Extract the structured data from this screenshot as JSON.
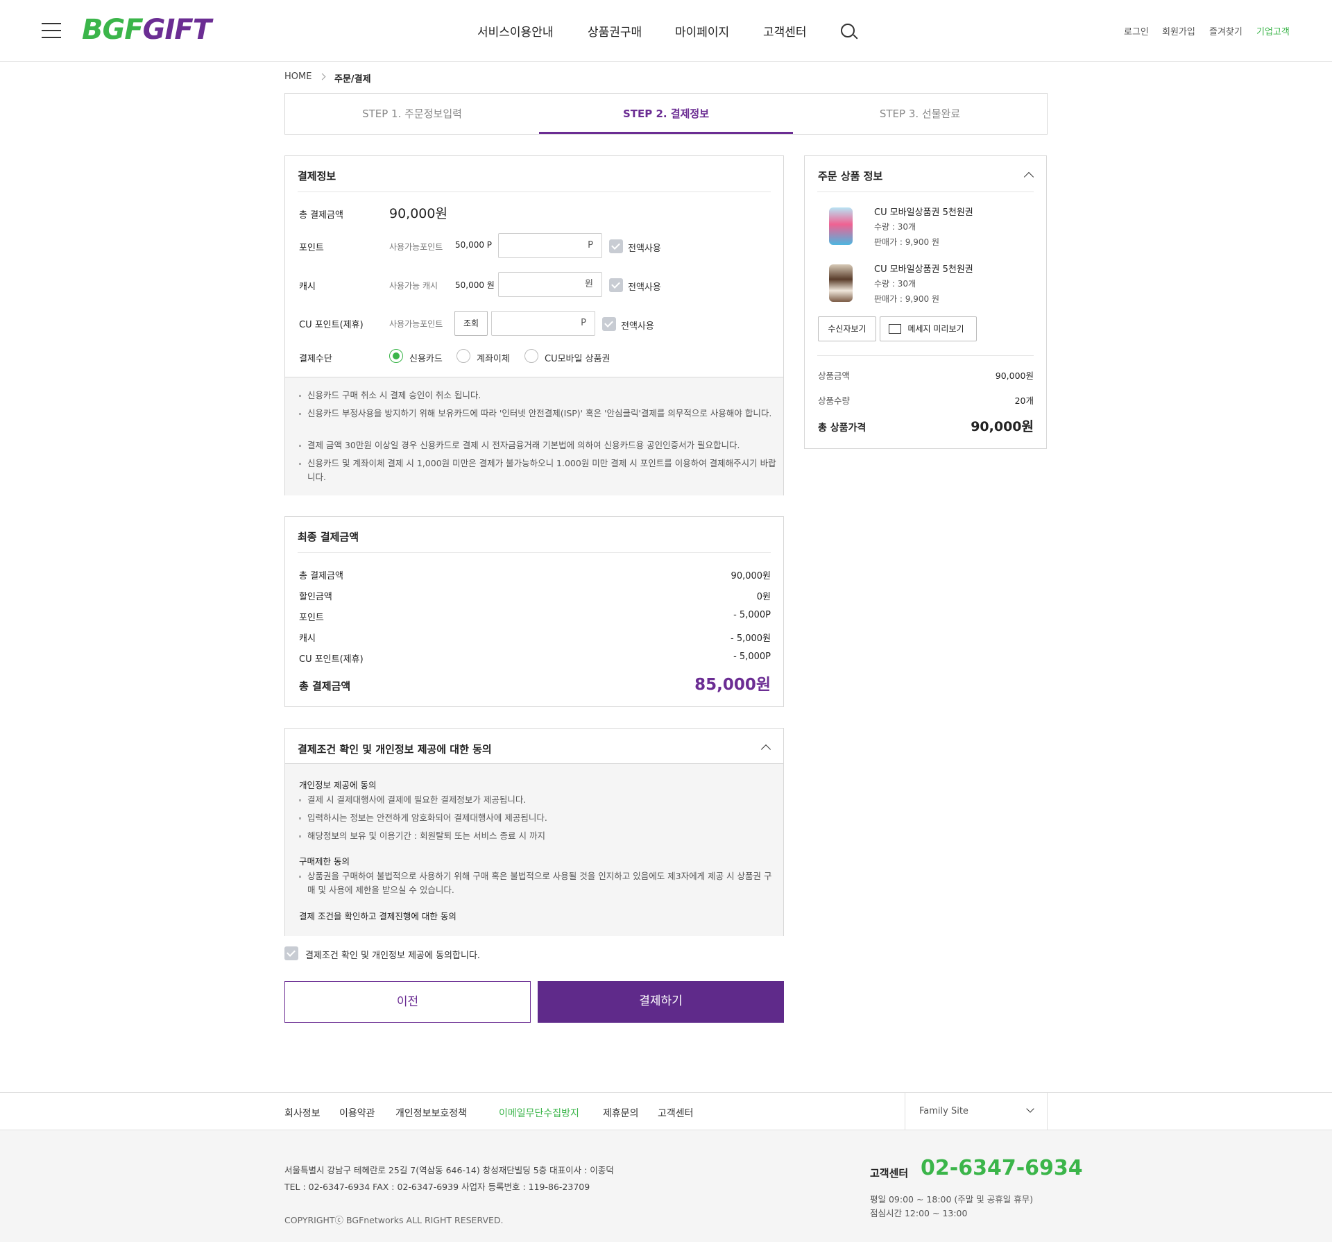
{
  "header": {
    "logo_left": "BGF",
    "logo_right": "GIFT",
    "nav": [
      "서비스이용안내",
      "상품권구매",
      "마이페이지",
      "고객센터"
    ],
    "util": [
      "로그인",
      "회원가입",
      "즐겨찾기",
      "기업고객"
    ]
  },
  "breadcrumb": {
    "home": "HOME",
    "current": "주문/결제"
  },
  "steps": [
    "STEP 1. 주문정보입력",
    "STEP 2. 결제정보",
    "STEP 3. 선물완료"
  ],
  "payment_info": {
    "title": "결제정보",
    "total_label": "총 결제금액",
    "total_value": "90,000원",
    "point": {
      "label": "포인트",
      "sub": "사용가능포인트",
      "avail": "50,000 P",
      "unit": "P",
      "check": "전액사용"
    },
    "cash": {
      "label": "캐시",
      "sub": "사용가능 캐시",
      "avail": "50,000 원",
      "unit": "원",
      "check": "전액사용"
    },
    "cupoint": {
      "label": "CU 포인트(제휴)",
      "sub": "사용가능포인트",
      "lookup": "조회",
      "unit": "P",
      "check": "전액사용"
    },
    "method": {
      "label": "결제수단",
      "options": [
        "신용카드",
        "계좌이체",
        "CU모바일 상품권"
      ],
      "selected": "신용카드"
    },
    "notices": [
      "신용카드 구매 취소 시 결제 승인이 취소 됩니다.",
      "신용카드 부정사용을 방지하기 위해 보유카드에 따라 '인터넷 안전결제(ISP)' 혹은 '안심클릭'결제를 의무적으로 사용해야 합니다.",
      "결제 금액 30만원 이상일 경우 신용카드로 결제 시 전자금융거래 기본법에 의하여 신용카드용 공인인증서가 필요합니다.",
      "신용카드 및 계좌이체 결제 시 1,000원 미만은 결제가 불가능하오니 1.000원 미만 결제 시 포인트를 이용하여 결제해주시기 바랍니다."
    ]
  },
  "final": {
    "title": "최종 결제금액",
    "rows": [
      {
        "label": "총 결제금액",
        "value": "90,000원"
      },
      {
        "label": "할인금액",
        "value": "0원"
      },
      {
        "label": "포인트",
        "value": "- 5,000P"
      },
      {
        "label": "캐시",
        "value": "- 5,000원"
      },
      {
        "label": "CU 포인트(제휴)",
        "value": "- 5,000P"
      }
    ],
    "total_label": "총 결제금액",
    "total_value": "85,000원"
  },
  "agree": {
    "title": "결제조건 확인 및 개인정보 제공에 대한 동의",
    "sec1_title": "개인정보 제공에 동의",
    "sec1_items": [
      "결제 시 결제대행사에 결제에 필요한 결제정보가 제공됩니다.",
      "입력하시는 정보는 안전하게 암호화되어 결제대행사에 제공됩니다.",
      "해당정보의 보유 및 이용기간 : 회원탈퇴 또는 서비스 종료 시 까지"
    ],
    "sec2_title": "구매제한 동의",
    "sec2_items": [
      "상품권을 구매하여 불법적으로 사용하기 위해 구매 혹은 불법적으로 사용될 것을 인지하고 있음에도 제3자에게 제공 시 상품권 구매 및 사용에 제한을 받으실 수 있습니다."
    ],
    "sec3_title": "결제 조건을 확인하고 결제진행에 대한 동의",
    "checkbox": "결제조건 확인 및 개인정보 제공에 동의합니다."
  },
  "buttons": {
    "prev": "이전",
    "pay": "결제하기"
  },
  "order_summary": {
    "title": "주문 상품 정보",
    "items": [
      {
        "name": "CU 모바일상품권 5천원권",
        "qty": "수량 : 30개",
        "price": "판매가 : 9,900 원"
      },
      {
        "name": "CU 모바일상품권 5천원권",
        "qty": "수량 : 30개",
        "price": "판매가 : 9,900 원"
      }
    ],
    "recipients_btn": "수신자보기",
    "preview_btn": "메세지 미리보기",
    "amount_label": "상품금액",
    "amount_value": "90,000원",
    "qty_label": "상품수량",
    "qty_value": "20개",
    "total_label": "총 상품가격",
    "total_value": "90,000원"
  },
  "footer": {
    "links": [
      "회사정보",
      "이용약관",
      "개인정보보호정책",
      "이메일무단수집방지",
      "제휴문의",
      "고객센터"
    ],
    "family_site": "Family Site",
    "address": "서울특별시 강남구 테헤란로 25길 7(역삼동 646-14) 창성재단빌딩 5층    대표이사 : 이종덕",
    "contact": "TEL : 02-6347-6934    FAX : 02-6347-6939    사업자 등록번호 : 119-86-23709",
    "copyright": "COPYRIGHTⓒ BGFnetworks ALL RIGHT RESERVED.",
    "cs_label": "고객센터",
    "cs_phone": "02-6347-6934",
    "cs_hours1": "평일 09:00 ~ 18:00 (주말 및 공휴일 휴무)",
    "cs_hours2": "점심시간 12:00 ~ 13:00"
  },
  "colors": {
    "brand_green": "#3bb54a",
    "brand_purple": "#6b2d93"
  }
}
